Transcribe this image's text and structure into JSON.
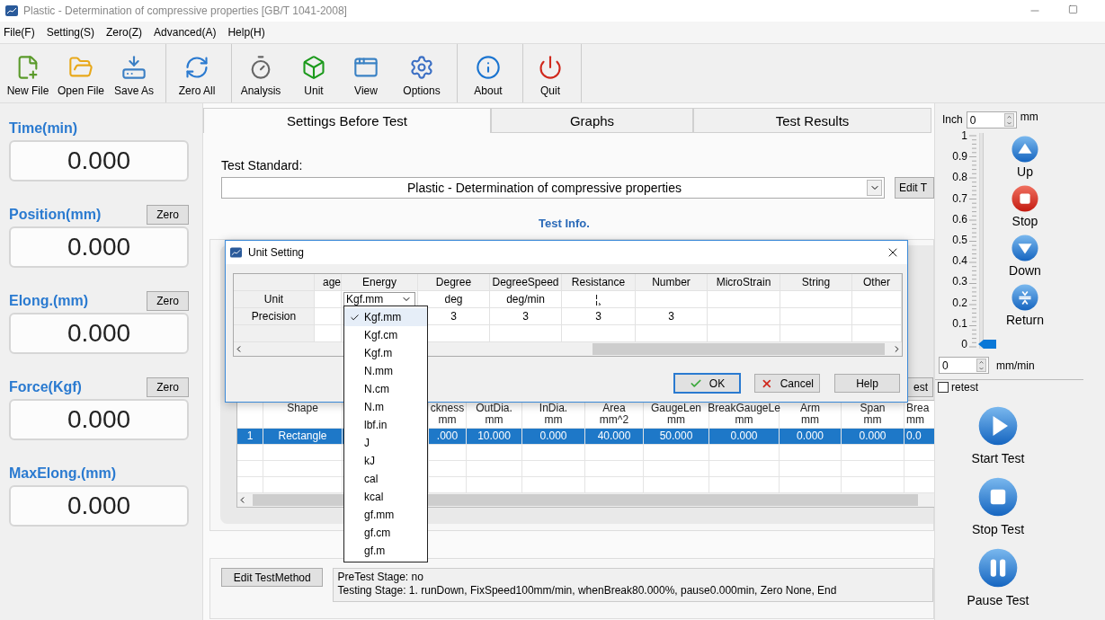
{
  "window": {
    "title": "Plastic - Determination of compressive properties [GB/T 1041-2008]"
  },
  "menu": [
    "File(F)",
    "Setting(S)",
    "Zero(Z)",
    "Advanced(A)",
    "Help(H)"
  ],
  "toolbar_groups": [
    {
      "buttons": [
        "New File",
        "Open File",
        "Save As"
      ]
    },
    {
      "buttons": [
        "Zero All"
      ]
    },
    {
      "buttons": [
        "Analysis",
        "Unit",
        "View",
        "Options"
      ]
    },
    {
      "buttons": [
        "About"
      ]
    },
    {
      "buttons": [
        "Quit"
      ]
    }
  ],
  "readouts": [
    {
      "label": "Time(min)",
      "value": "0.000"
    },
    {
      "label": "Position(mm)",
      "value": "0.000",
      "zero_button": "Zero"
    },
    {
      "label": "Elong.(mm)",
      "value": "0.000",
      "zero_button": "Zero"
    },
    {
      "label": "Force(Kgf)",
      "value": "0.000",
      "zero_button": "Zero"
    },
    {
      "label": "MaxElong.(mm)",
      "value": "0.000"
    }
  ],
  "tabs": [
    {
      "label": "Settings Before Test",
      "selected": true
    },
    {
      "label": "Graphs",
      "selected": false
    },
    {
      "label": "Test Results",
      "selected": false
    }
  ],
  "settings": {
    "standard_label": "Test Standard:",
    "standard_value": "Plastic - Determination of compressive properties",
    "edit_button": "Edit T",
    "section_title": "Test Info.",
    "partial_button": "est",
    "sample_table": {
      "columns": [
        null,
        "Shape",
        null,
        "ckness\nmm",
        "OutDia.\nmm",
        "InDia.\nmm",
        "Area\nmm^2",
        "GaugeLen\nmm",
        "BreakGaugeLe\nmm",
        "Arm\nmm",
        "Span\nmm",
        "Brea\nmm"
      ],
      "rows": [
        {
          "selected": true,
          "cells": [
            "1",
            "Rectangle",
            null,
            ".000",
            "10.000",
            "0.000",
            "40.000",
            "50.000",
            "0.000",
            "0.000",
            "0.000",
            "0.0"
          ]
        }
      ]
    },
    "method_button": "Edit TestMethod",
    "method_text": [
      "PreTest Stage:  no",
      "Testing Stage:  1.  runDown,  FixSpeed100mm/min,  whenBreak80.000%,  pause0.000min,  Zero None,  End"
    ]
  },
  "dialog": {
    "title": "Unit Setting",
    "columns": [
      null,
      "age",
      "Energy",
      "Degree",
      "DegreeSpeed",
      "Resistance",
      "Number",
      "MicroStrain",
      "String",
      "Other"
    ],
    "rows": [
      {
        "cells": [
          {
            "kind": "header",
            "text": "Unit"
          },
          {
            "kind": "empty"
          },
          {
            "kind": "combo",
            "text": "Kgf.mm"
          },
          {
            "kind": "text",
            "text": "deg"
          },
          {
            "kind": "text",
            "text": "deg/min"
          },
          {
            "kind": "text",
            "text": "¦¸"
          },
          {
            "kind": "empty"
          },
          {
            "kind": "empty"
          },
          {
            "kind": "empty"
          },
          {
            "kind": "empty"
          }
        ]
      },
      {
        "cells": [
          {
            "kind": "header",
            "text": "Precision"
          },
          {
            "kind": "empty"
          },
          {
            "kind": "empty"
          },
          {
            "kind": "text",
            "text": "3"
          },
          {
            "kind": "text",
            "text": "3"
          },
          {
            "kind": "text",
            "text": "3"
          },
          {
            "kind": "text",
            "text": "3"
          },
          {
            "kind": "empty"
          },
          {
            "kind": "empty"
          },
          {
            "kind": "empty"
          }
        ]
      }
    ],
    "buttons": [
      {
        "label": "OK",
        "kind": "ok"
      },
      {
        "label": "Cancel",
        "kind": "cancel"
      },
      {
        "label": "Help",
        "kind": "plain"
      }
    ],
    "dropdown": [
      {
        "label": "Kgf.mm",
        "selected": true
      },
      {
        "label": "Kgf.cm",
        "selected": false
      },
      {
        "label": "Kgf.m",
        "selected": false
      },
      {
        "label": "N.mm",
        "selected": false
      },
      {
        "label": "N.cm",
        "selected": false
      },
      {
        "label": "N.m",
        "selected": false
      },
      {
        "label": "lbf.in",
        "selected": false
      },
      {
        "label": "J",
        "selected": false
      },
      {
        "label": "kJ",
        "selected": false
      },
      {
        "label": "cal",
        "selected": false
      },
      {
        "label": "kcal",
        "selected": false
      },
      {
        "label": "gf.mm",
        "selected": false
      },
      {
        "label": "gf.cm",
        "selected": false
      },
      {
        "label": "gf.m",
        "selected": false
      }
    ]
  },
  "jog": {
    "unit_left": "Inch",
    "value": "0",
    "unit_right": "mm",
    "scale": [
      "1",
      "0.9",
      "0.8",
      "0.7",
      "0.6",
      "0.5",
      "0.4",
      "0.3",
      "0.2",
      "0.1",
      "0"
    ],
    "level": 0,
    "buttons": [
      {
        "label": "Up",
        "kind": "up"
      },
      {
        "label": "Stop",
        "kind": "stop"
      },
      {
        "label": "Down",
        "kind": "down"
      },
      {
        "label": "Return",
        "kind": "return"
      }
    ],
    "speed": {
      "value": "0",
      "unit": "mm/min"
    },
    "retest": {
      "label": "retest",
      "checked": false
    },
    "test_buttons": [
      {
        "label": "Start Test",
        "kind": "start"
      },
      {
        "label": "Stop Test",
        "kind": "halt"
      },
      {
        "label": "Pause Test",
        "kind": "pause"
      }
    ]
  }
}
